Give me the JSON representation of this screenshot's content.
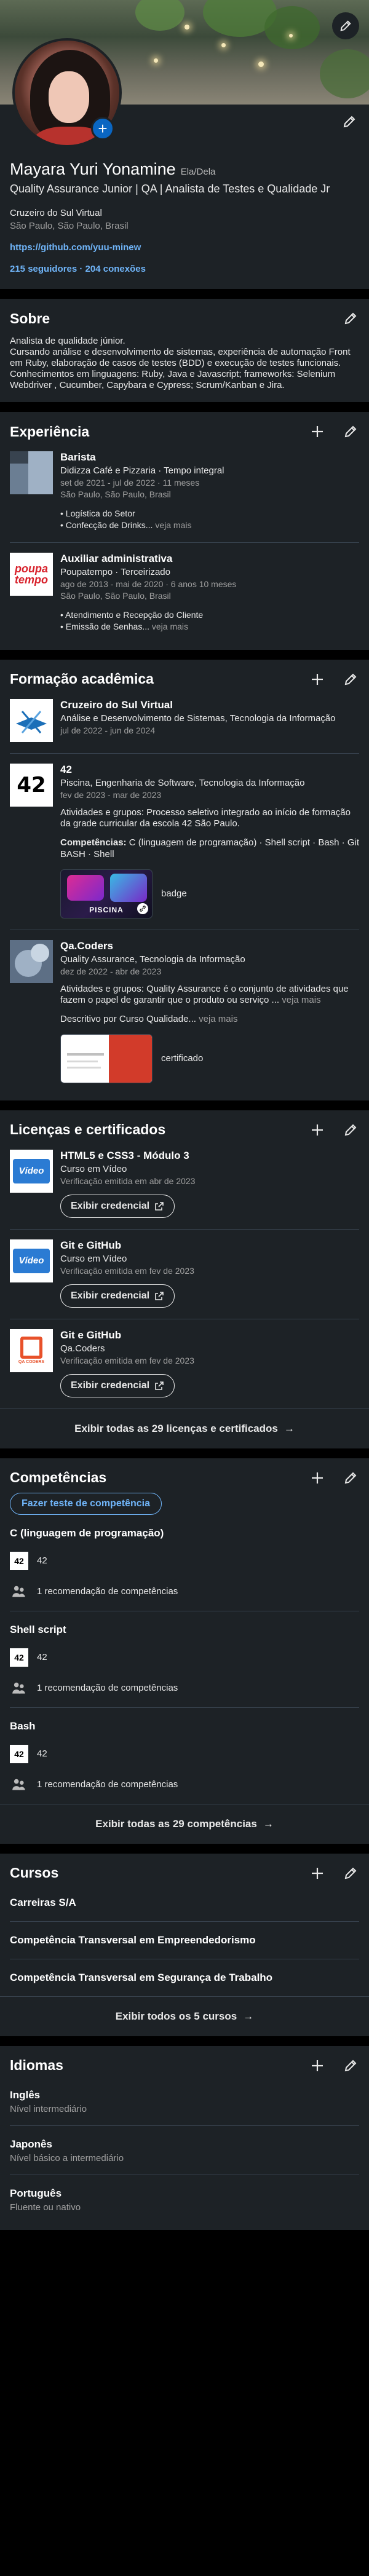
{
  "profile": {
    "name": "Mayara Yuri Yonamine",
    "pronouns": "Ela/Dela",
    "headline": "Quality Assurance Junior | QA | Analista de Testes e Qualidade Jr",
    "education": "Cruzeiro do Sul Virtual",
    "location": "São Paulo, São Paulo, Brasil",
    "github": "https://github.com/yuu-minew",
    "followers": "215 seguidores · 204 conexões",
    "add_photo_label": "+"
  },
  "about": {
    "title": "Sobre",
    "lines": [
      "Analista de qualidade júnior.",
      "Cursando análise e desenvolvimento de sistemas, experiência de automação Front em Ruby, elaboração de casos de testes (BDD) e execução de testes funcionais.",
      "Conhecimentos em linguagens: Ruby, Java e Javascript; frameworks: Selenium Webdriver , Cucumber, Capybara e Cypress;  Scrum/Kanban e Jira."
    ]
  },
  "experience": {
    "title": "Experiência",
    "items": [
      {
        "title": "Barista",
        "company": "Didizza Café e Pizzaria · Tempo integral",
        "dates": "set de 2021 - jul de 2022 · 11 meses",
        "location": "São Paulo, São Paulo, Brasil",
        "bullets": [
          "Logística do Setor",
          "Confecção de Drinks..."
        ],
        "more": "veja mais"
      },
      {
        "title": "Auxiliar administrativa",
        "company": "Poupatempo · Terceirizado",
        "dates": "ago de 2013 - mai de 2020 · 6 anos 10 meses",
        "location": "São Paulo, São Paulo, Brasil",
        "logo_text_1": "poupa",
        "logo_text_2": "tempo",
        "bullets": [
          "Atendimento e Recepção do Cliente",
          "Emissão de Senhas..."
        ],
        "more": "veja mais"
      }
    ]
  },
  "education": {
    "title": "Formação acadêmica",
    "items": [
      {
        "title": "Cruzeiro do Sul Virtual",
        "degree": "Análise e Desenvolvimento de Sistemas, Tecnologia da Informação",
        "dates": "jul de 2022 - jun de 2024"
      },
      {
        "title": "42",
        "logo_text": "42",
        "degree": "Piscina, Engenharia de Software, Tecnologia da Informação",
        "dates": "fev de 2023 - mar de 2023",
        "activities": "Atividades e grupos: Processo seletivo integrado ao início de formação da grade curricular da escola 42 São Paulo.",
        "skills_label": "Competências:",
        "skills": "C (linguagem de programação) · Shell script · Bash · Git BASH · Shell",
        "media_label": "badge",
        "media_text": "PISCINA"
      },
      {
        "title": "Qa.Coders",
        "degree": "Quality Assurance, Tecnologia da Informação",
        "dates": "dez de 2022 - abr de 2023",
        "activities": "Atividades e grupos: Quality Assurance é o conjunto de atividades que fazem o papel de garantir que o produto ou serviço ...",
        "activities_more": "veja mais",
        "description": "Descritivo por Curso Qualidade...",
        "description_more": "veja mais",
        "media_label": "certificado"
      }
    ]
  },
  "licenses": {
    "title": "Licenças e certificados",
    "items": [
      {
        "title": "HTML5 e CSS3 - Módulo 3",
        "issuer": "Curso em Vídeo",
        "date": "Verificação emitida em abr de 2023",
        "button": "Exibir credencial",
        "logo_text": "Vídeo"
      },
      {
        "title": "Git e GitHub",
        "issuer": "Curso em Vídeo",
        "date": "Verificação emitida em fev de 2023",
        "button": "Exibir credencial",
        "logo_text": "Vídeo"
      },
      {
        "title": "Git e GitHub",
        "issuer": "Qa.Coders",
        "date": "Verificação emitida em fev de 2023",
        "button": "Exibir credencial",
        "logo_text": "QA CODERS"
      }
    ],
    "show_all": "Exibir todas as 29 licenças e certificados"
  },
  "skills": {
    "title": "Competências",
    "test_button": "Fazer teste de competência",
    "items": [
      {
        "name": "C (linguagem de programação)",
        "source": "42",
        "endorsements": "1 recomendação de competências"
      },
      {
        "name": "Shell script",
        "source": "42",
        "endorsements": "1 recomendação de competências"
      },
      {
        "name": "Bash",
        "source": "42",
        "endorsements": "1 recomendação de competências"
      }
    ],
    "show_all": "Exibir todas as 29 competências"
  },
  "courses": {
    "title": "Cursos",
    "items": [
      "Carreiras S/A",
      "Competência Transversal em Empreendedorismo",
      "Competência Transversal em Segurança de Trabalho"
    ],
    "show_all": "Exibir todos os 5 cursos"
  },
  "languages": {
    "title": "Idiomas",
    "items": [
      {
        "name": "Inglês",
        "level": "Nível intermediário"
      },
      {
        "name": "Japonês",
        "level": "Nível básico a intermediário"
      },
      {
        "name": "Português",
        "level": "Fluente ou nativo"
      }
    ]
  },
  "colors": {
    "background": "#000000",
    "card": "#1d2226",
    "accent_link": "#70b5f9",
    "primary_blue": "#0a66c2",
    "divider": "#38434f"
  }
}
